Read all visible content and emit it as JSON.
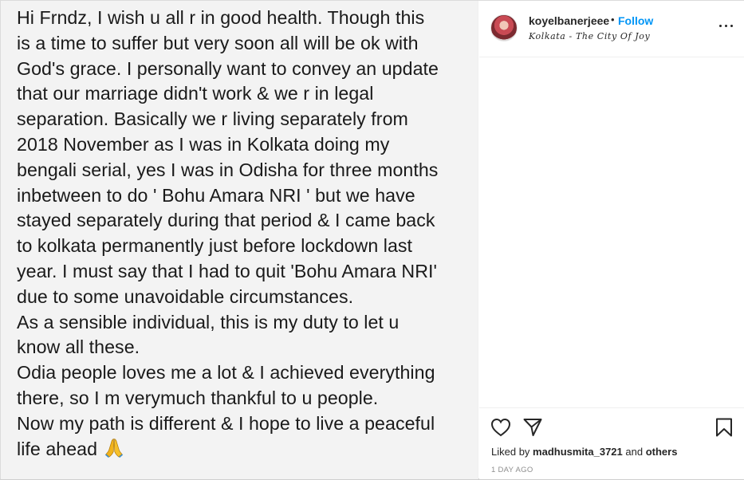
{
  "post": {
    "lines": [
      "Hi Frndz, I wish u all r in good health. Though this",
      "is a time to suffer but very soon all will be ok with",
      "God's grace. I personally want to convey an update",
      "that our marriage didn't work & we r in legal",
      "separation. Basically we r living separately from",
      "2018 November as I was in Kolkata doing my",
      "bengali serial, yes I was in Odisha for three months",
      "inbetween to do ' Bohu Amara NRI ' but we have",
      "stayed separately during that period & I came back",
      "to kolkata permanently just before lockdown last",
      "year. I must say that I had to quit 'Bohu Amara NRI'",
      "due to some unavoidable circumstances.",
      "As a sensible individual, this is my duty to let u",
      "know all these.",
      "Odia people loves me a lot & I achieved everything",
      "there, so I m verymuch thankful to u people.",
      "Now my path is different & I hope to live a peaceful",
      "life ahead"
    ],
    "emoji": "folded-hands-icon"
  },
  "header": {
    "username": "koyelbanerjeee",
    "separator": "•",
    "follow_label": "Follow",
    "location": "Kolkata - The City Of Joy"
  },
  "actions": {
    "liked_prefix": "Liked by ",
    "liked_user": "madhusmita_3721",
    "liked_middle": " and ",
    "liked_others": "others",
    "timestamp": "1 DAY AGO"
  },
  "colors": {
    "follow": "#0095f6",
    "text": "#262626",
    "muted": "#8e8e8e",
    "emoji": "#f2b31b"
  }
}
